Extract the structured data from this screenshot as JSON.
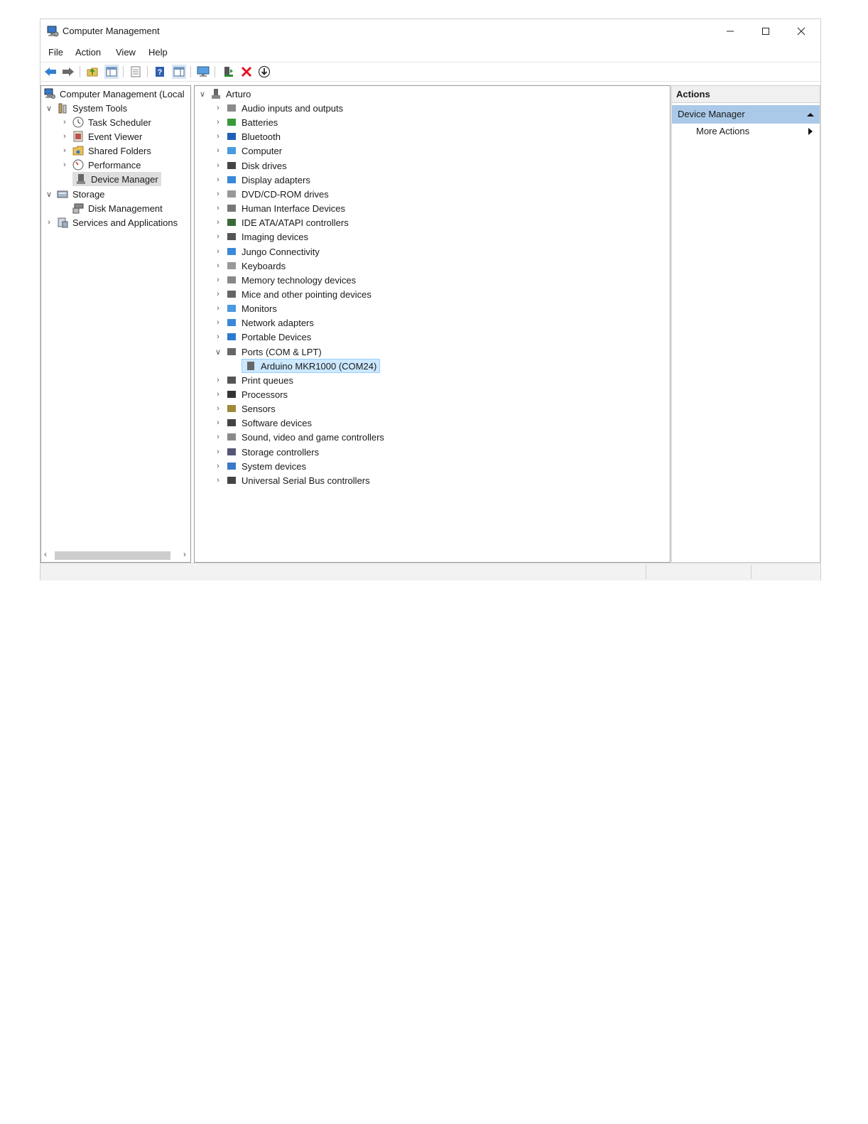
{
  "window": {
    "title": "Computer Management",
    "controls": {
      "minimize_icon": "minimize-icon",
      "maximize_icon": "maximize-icon",
      "close_icon": "close-icon"
    }
  },
  "menu": [
    "File",
    "Action",
    "View",
    "Help"
  ],
  "toolbar": {
    "icons": [
      "back-arrow-icon",
      "forward-arrow-icon",
      "up-folder-icon",
      "show-hide-console-tree-icon",
      "properties-icon",
      "help-icon",
      "show-hide-action-pane-icon",
      "monitor-icon",
      "update-driver-icon",
      "uninstall-device-icon",
      "scan-hardware-icon"
    ],
    "colors": {
      "arrow": "#2f7fd1",
      "delete": "#e81123"
    }
  },
  "left_tree": {
    "root": "Computer Management (Local",
    "system_tools": "System Tools",
    "task_scheduler": "Task Scheduler",
    "event_viewer": "Event Viewer",
    "shared_folders": "Shared Folders",
    "performance": "Performance",
    "device_manager": "Device Manager",
    "storage": "Storage",
    "disk_management": "Disk Management",
    "services_apps": "Services and Applications"
  },
  "device_tree": {
    "root": "Arturo",
    "categories": [
      "Audio inputs and outputs",
      "Batteries",
      "Bluetooth",
      "Computer",
      "Disk drives",
      "Display adapters",
      "DVD/CD-ROM drives",
      "Human Interface Devices",
      "IDE ATA/ATAPI controllers",
      "Imaging devices",
      "Jungo Connectivity",
      "Keyboards",
      "Memory technology devices",
      "Mice and other pointing devices",
      "Monitors",
      "Network adapters",
      "Portable Devices",
      "Ports (COM & LPT)",
      "Print queues",
      "Processors",
      "Sensors",
      "Software devices",
      "Sound, video and game controllers",
      "Storage controllers",
      "System devices",
      "Universal Serial Bus controllers"
    ],
    "expanded_child": "Arduino MKR1000 (COM24)"
  },
  "actions": {
    "header": "Actions",
    "section": "Device Manager",
    "more_actions": "More Actions",
    "section_color": "#aac9e8"
  }
}
